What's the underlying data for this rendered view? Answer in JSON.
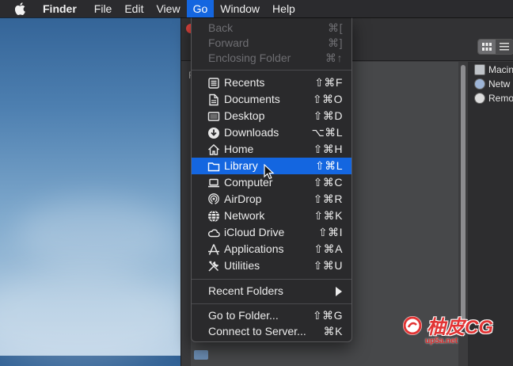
{
  "menubar": {
    "app_name": "Finder",
    "items": [
      "File",
      "Edit",
      "View",
      "Go",
      "Window",
      "Help"
    ],
    "active": "Go"
  },
  "go_menu": {
    "top": [
      {
        "label": "Back",
        "shortcut": "⌘[",
        "enabled": false
      },
      {
        "label": "Forward",
        "shortcut": "⌘]",
        "enabled": false
      },
      {
        "label": "Enclosing Folder",
        "shortcut": "⌘↑",
        "enabled": false
      }
    ],
    "places": [
      {
        "label": "Recents",
        "shortcut": "⇧⌘F",
        "icon": "recents-icon"
      },
      {
        "label": "Documents",
        "shortcut": "⇧⌘O",
        "icon": "documents-icon"
      },
      {
        "label": "Desktop",
        "shortcut": "⇧⌘D",
        "icon": "desktop-icon"
      },
      {
        "label": "Downloads",
        "shortcut": "⌥⌘L",
        "icon": "downloads-icon"
      },
      {
        "label": "Home",
        "shortcut": "⇧⌘H",
        "icon": "home-icon"
      },
      {
        "label": "Library",
        "shortcut": "⇧⌘L",
        "icon": "folder-icon",
        "highlighted": true
      },
      {
        "label": "Computer",
        "shortcut": "⇧⌘C",
        "icon": "computer-icon"
      },
      {
        "label": "AirDrop",
        "shortcut": "⇧⌘R",
        "icon": "airdrop-icon"
      },
      {
        "label": "Network",
        "shortcut": "⇧⌘K",
        "icon": "network-icon"
      },
      {
        "label": "iCloud Drive",
        "shortcut": "⇧⌘I",
        "icon": "icloud-icon"
      },
      {
        "label": "Applications",
        "shortcut": "⇧⌘A",
        "icon": "applications-icon"
      },
      {
        "label": "Utilities",
        "shortcut": "⇧⌘U",
        "icon": "utilities-icon"
      }
    ],
    "recent_folders": {
      "label": "Recent Folders"
    },
    "bottom": [
      {
        "label": "Go to Folder...",
        "shortcut": "⇧⌘G"
      },
      {
        "label": "Connect to Server...",
        "shortcut": "⌘K"
      }
    ]
  },
  "finder_window": {
    "sidebar_letter": "F",
    "right_panel": [
      {
        "label": "Macin"
      },
      {
        "label": "Netw"
      },
      {
        "label": "Remo"
      }
    ]
  },
  "watermark": {
    "main": "柚皮CG",
    "sub": "up5a.net"
  },
  "colors": {
    "highlight": "#1466e0",
    "menubar_bg": "#2b2b2e",
    "menu_bg": "#2a2a2c"
  }
}
